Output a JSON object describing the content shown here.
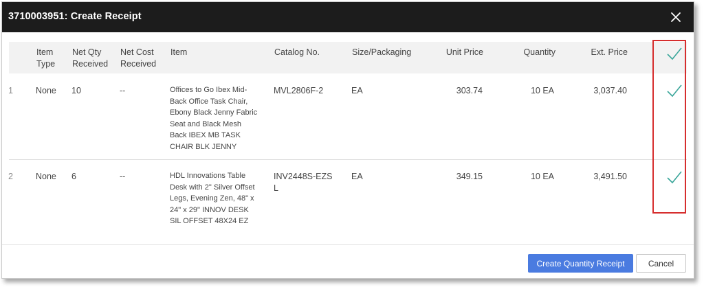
{
  "dialog": {
    "title": "3710003951: Create Receipt",
    "close_icon": "close-icon"
  },
  "table": {
    "headers": {
      "item_type": "Item\nType",
      "net_qty": "Net Qty\nReceived",
      "net_cost": "Net Cost\nReceived",
      "item": "Item",
      "catalog": "Catalog No.",
      "size": "Size/Packaging",
      "unit_price": "Unit Price",
      "quantity": "Quantity",
      "ext_price": "Ext. Price",
      "select_all_icon": "checkmark-icon"
    },
    "rows": [
      {
        "num": "1",
        "item_type": "None",
        "net_qty": "10",
        "net_cost": "--",
        "item": "Offices to Go Ibex Mid-Back Office Task Chair, Ebony Black Jenny Fabric Seat and Black Mesh Back IBEX MB TASK CHAIR BLK JENNY",
        "catalog": "MVL2806F-2",
        "size": "EA",
        "unit_price": "303.74",
        "quantity": "10 EA",
        "ext_price": "3,037.40",
        "selected": true
      },
      {
        "num": "2",
        "item_type": "None",
        "net_qty": "6",
        "net_cost": "--",
        "item": "HDL Innovations Table Desk with 2\" Silver Offset Legs, Evening Zen, 48\" x 24\" x 29\" INNOV DESK SIL OFFSET 48X24 EZ",
        "catalog": "INV2448S-EZSL",
        "size": "EA",
        "unit_price": "349.15",
        "quantity": "10 EA",
        "ext_price": "3,491.50",
        "selected": true
      }
    ]
  },
  "footer": {
    "primary_label": "Create Quantity Receipt",
    "cancel_label": "Cancel"
  },
  "colors": {
    "titlebar": "#1c1c1c",
    "primary_button": "#4a7be0",
    "check": "#3aa69a",
    "highlight": "#d62d2d"
  }
}
